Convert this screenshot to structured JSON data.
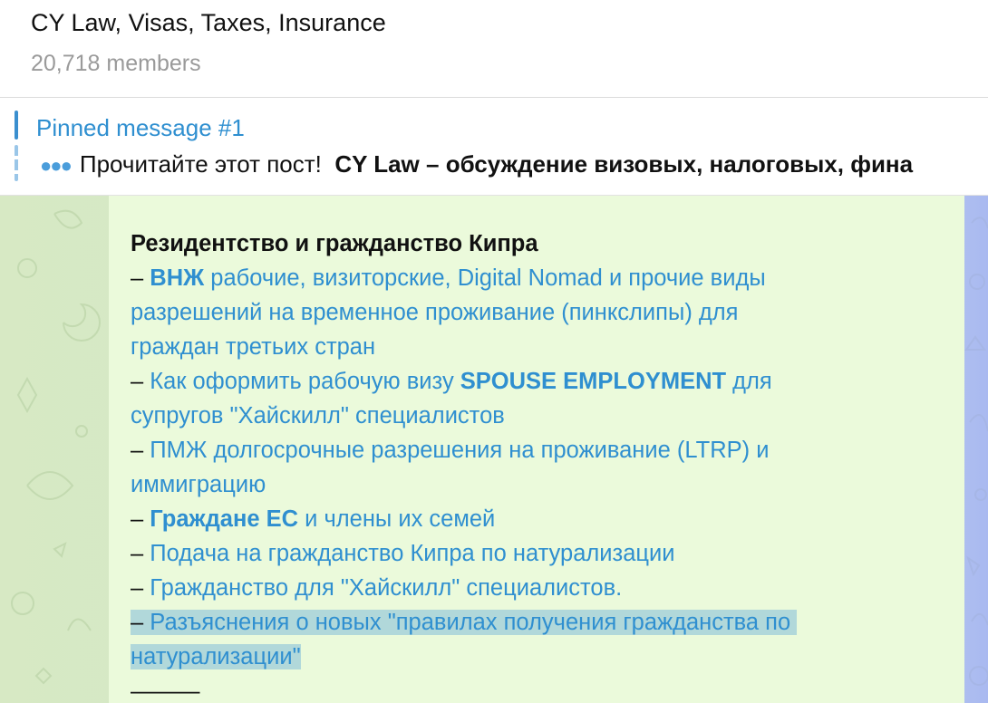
{
  "header": {
    "title": "CY Law, Visas, Taxes, Insurance",
    "members": "20,718 members"
  },
  "pinned": {
    "title": "Pinned message #1",
    "preview_prefix": "Прочитайте этот пост!",
    "preview_bold": "CY Law – обсуждение визовых, налоговых, фина"
  },
  "message": {
    "heading": "Резидентство и гражданство Кипра",
    "dash": "–",
    "item1_bold": "ВНЖ",
    "item1_rest_a": " рабочие, визиторские, Digital Nomad и прочие виды",
    "item1_rest_b": "разрешений на временное проживание (пинкслипы) для",
    "item1_rest_c": "граждан третьих стран",
    "item2_a": "Как оформить рабочую визу ",
    "item2_bold": "SPOUSE EMPLOYMENT",
    "item2_b": " для",
    "item2_c": "супругов \"Хайскилл\" специалистов",
    "item3_a": "ПМЖ долгосрочные разрешения на проживание (LTRP) и",
    "item3_b": "иммиграцию",
    "item4_bold": "Граждане ЕС",
    "item4_rest": " и члены их семей",
    "item5": "Подача на гражданство Кипра по натурализации",
    "item6": "Гражданство для \"Хайскилл\" специалистов.",
    "item7_a": "Разъяснения о новых \"правилах получения гражданства по",
    "item7_b": "натурализации\"",
    "separator": "———"
  }
}
